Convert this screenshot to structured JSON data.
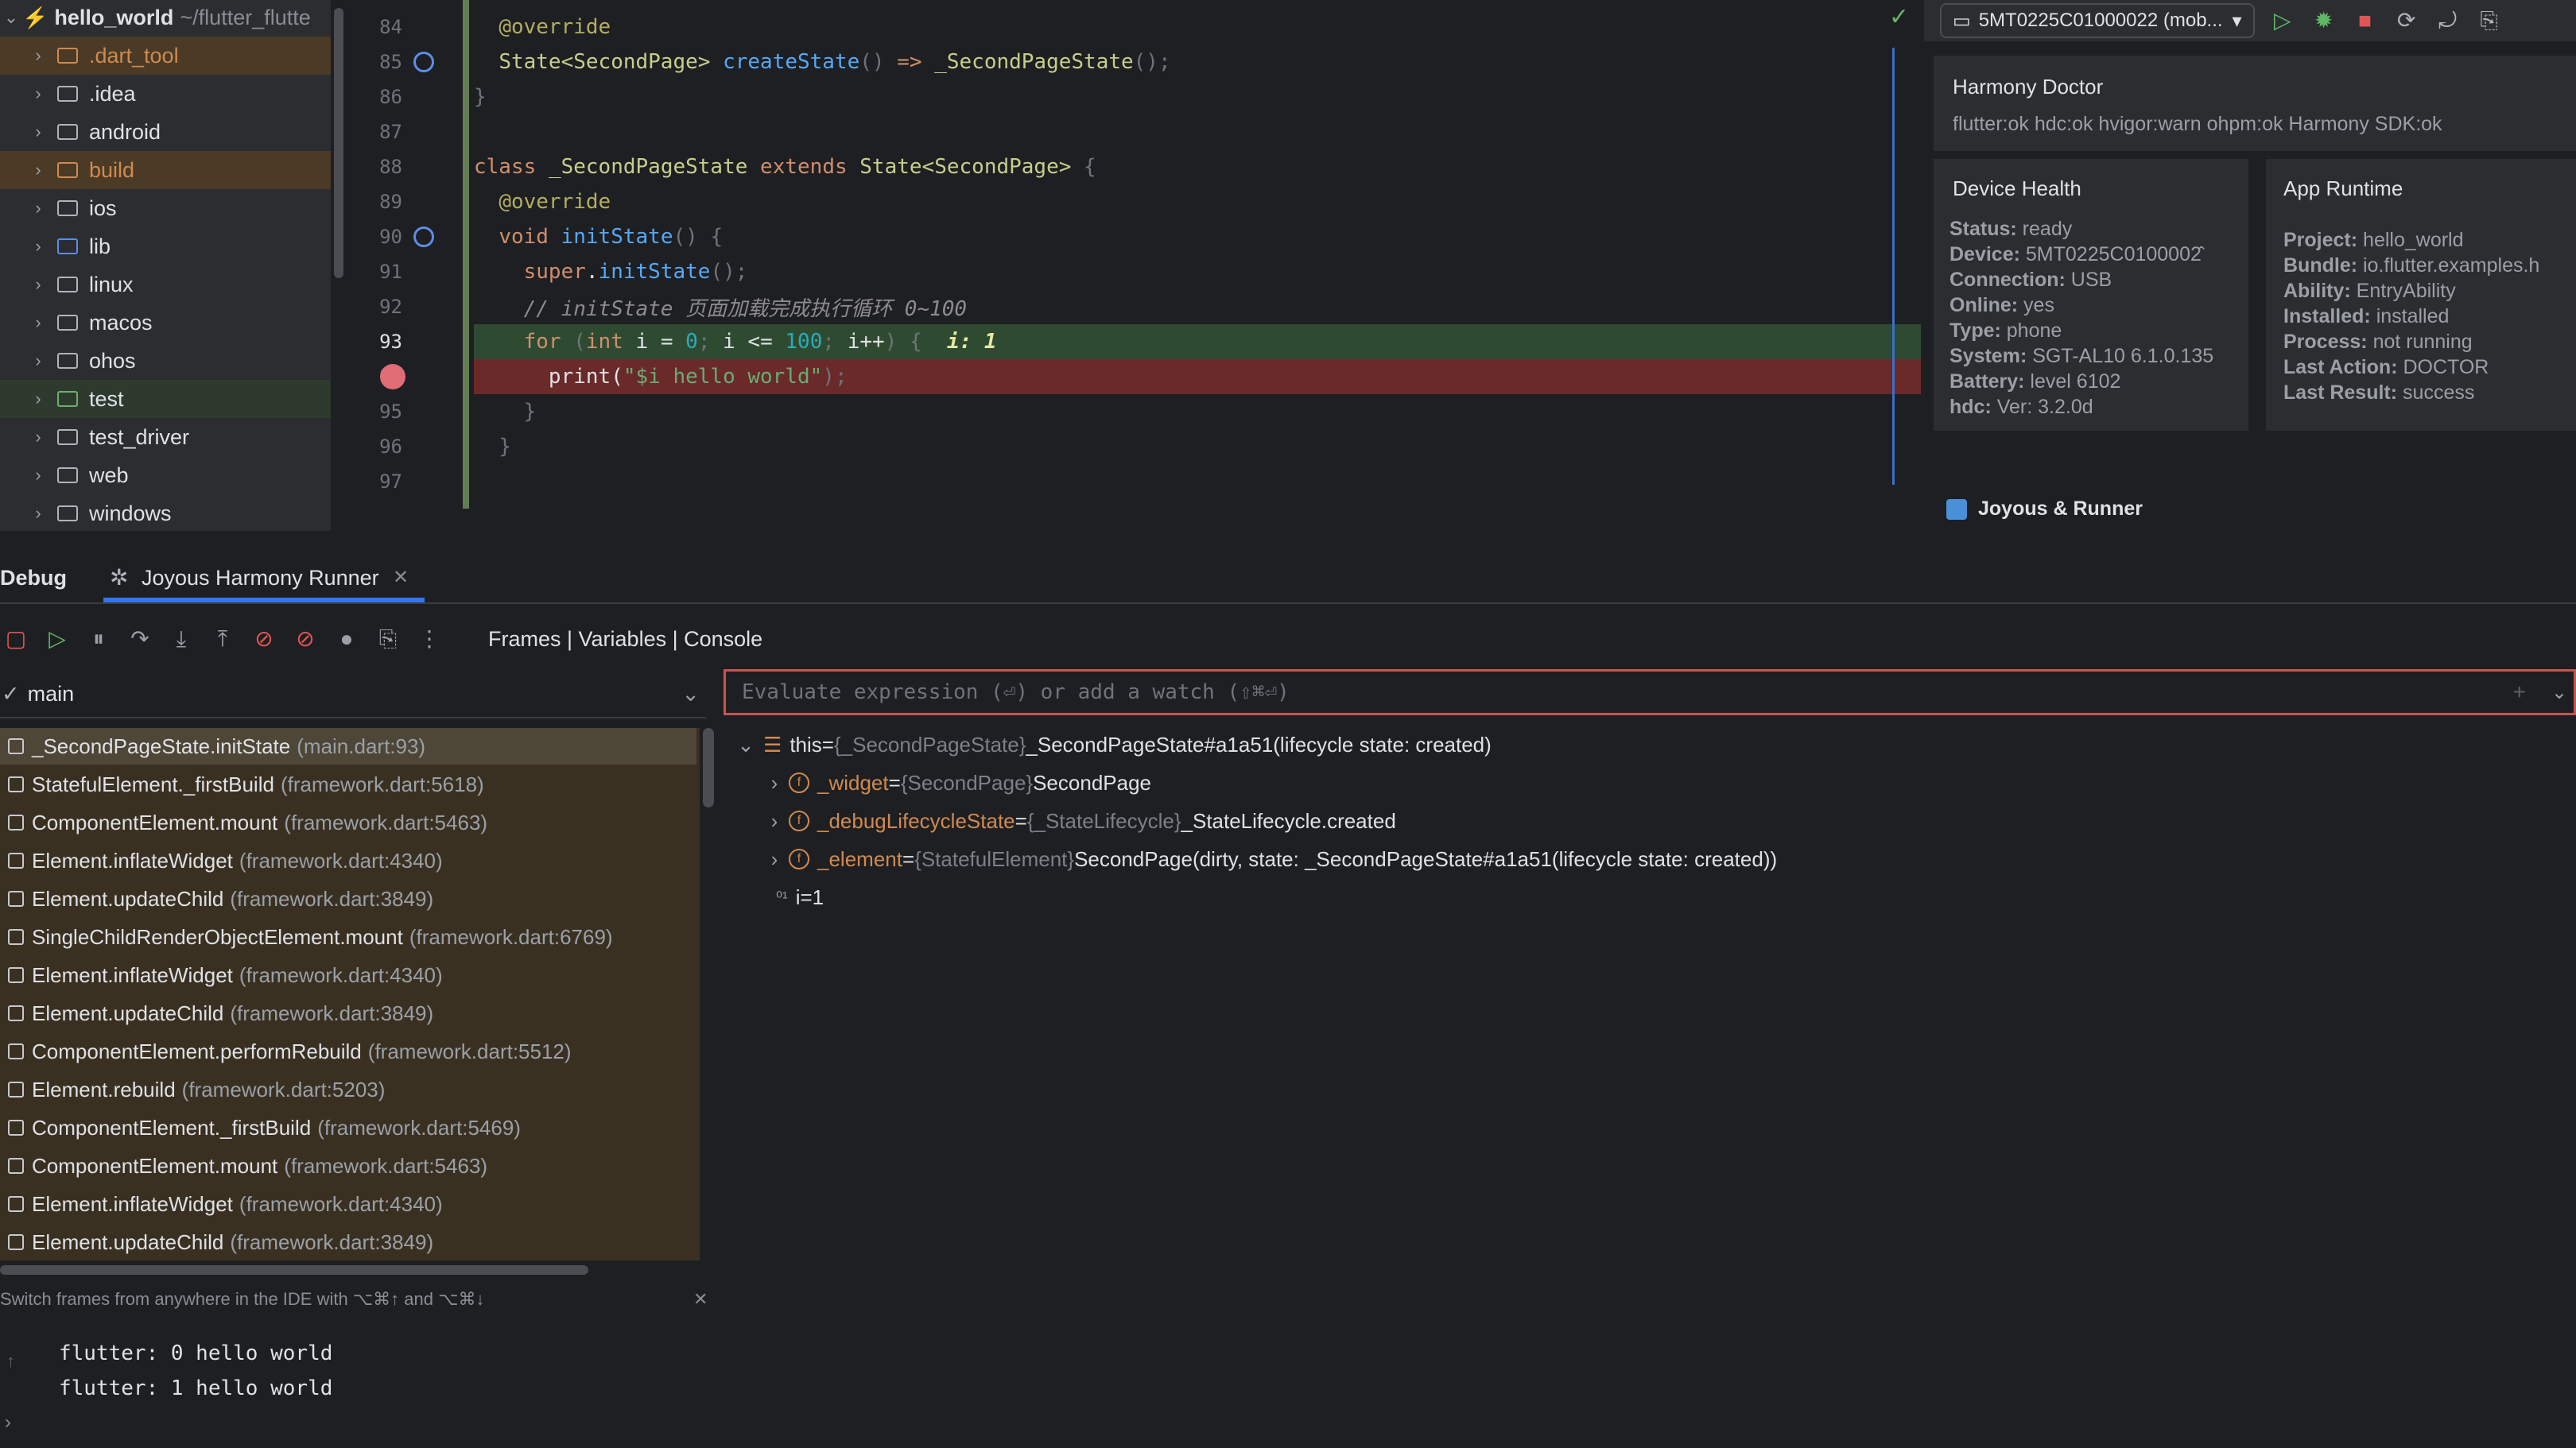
{
  "project": {
    "root_name": "hello_world",
    "root_path": "~/flutter_flutte"
  },
  "tree": [
    {
      "label": ".dart_tool",
      "style": "orange"
    },
    {
      "label": ".idea",
      "style": "normal"
    },
    {
      "label": "android",
      "style": "normal"
    },
    {
      "label": "build",
      "style": "orange"
    },
    {
      "label": "ios",
      "style": "normal"
    },
    {
      "label": "lib",
      "style": "blue"
    },
    {
      "label": "linux",
      "style": "normal"
    },
    {
      "label": "macos",
      "style": "normal"
    },
    {
      "label": "ohos",
      "style": "normal"
    },
    {
      "label": "test",
      "style": "green"
    },
    {
      "label": "test_driver",
      "style": "normal"
    },
    {
      "label": "web",
      "style": "normal"
    },
    {
      "label": "windows",
      "style": "normal"
    }
  ],
  "editor": {
    "line_numbers": [
      "84",
      "85",
      "86",
      "87",
      "88",
      "89",
      "90",
      "91",
      "92",
      "93",
      "94",
      "95",
      "96",
      "97"
    ],
    "current_line": "93",
    "inline_hint": "i: 1"
  },
  "toolbar": {
    "device": "5MT0225C01000022 (mob..."
  },
  "doctor": {
    "title": "Harmony Doctor",
    "status_line": "flutter:ok  hdc:ok  hvigor:warn  ohpm:ok  Harmony SDK:ok"
  },
  "device_health": {
    "title": "Device Health",
    "rows": [
      {
        "k": "Status:",
        "v": " ready"
      },
      {
        "k": "Device:",
        "v": " 5MT0225C0100002̂"
      },
      {
        "k": "Connection:",
        "v": " USB"
      },
      {
        "k": "Online:",
        "v": " yes"
      },
      {
        "k": "Type:",
        "v": " phone"
      },
      {
        "k": "System:",
        "v": " SGT-AL10 6.1.0.135"
      },
      {
        "k": "Battery:",
        "v": " level 6102"
      },
      {
        "k": "hdc:",
        "v": " Ver: 3.2.0d"
      }
    ]
  },
  "app_runtime": {
    "title": "App Runtime",
    "rows": [
      {
        "k": "Project:",
        "v": " hello_world"
      },
      {
        "k": "Bundle:",
        "v": " io.flutter.examples.h"
      },
      {
        "k": "Ability:",
        "v": " EntryAbility"
      },
      {
        "k": "Installed:",
        "v": " installed"
      },
      {
        "k": "Process:",
        "v": " not running"
      },
      {
        "k": "Last Action:",
        "v": " DOCTOR"
      },
      {
        "k": "Last Result:",
        "v": " success"
      }
    ]
  },
  "runner_label": "Joyous & Runner",
  "debug": {
    "tab_debug": "Debug",
    "tab_runner": "Joyous Harmony Runner",
    "panel_title": "Frames | Variables | Console",
    "thread": "main",
    "eval_placeholder": "Evaluate expression (⏎) or add a watch (⇧⌘⏎)",
    "hint": "Switch frames from anywhere in the IDE with ⌥⌘↑ and ⌥⌘↓"
  },
  "frames": [
    {
      "name": "_SecondPageState.initState",
      "loc": "(main.dart:93)"
    },
    {
      "name": "StatefulElement._firstBuild",
      "loc": "(framework.dart:5618)"
    },
    {
      "name": "ComponentElement.mount",
      "loc": "(framework.dart:5463)"
    },
    {
      "name": "Element.inflateWidget",
      "loc": "(framework.dart:4340)"
    },
    {
      "name": "Element.updateChild",
      "loc": "(framework.dart:3849)"
    },
    {
      "name": "SingleChildRenderObjectElement.mount",
      "loc": "(framework.dart:6769)"
    },
    {
      "name": "Element.inflateWidget",
      "loc": "(framework.dart:4340)"
    },
    {
      "name": "Element.updateChild",
      "loc": "(framework.dart:3849)"
    },
    {
      "name": "ComponentElement.performRebuild",
      "loc": "(framework.dart:5512)"
    },
    {
      "name": "Element.rebuild",
      "loc": "(framework.dart:5203)"
    },
    {
      "name": "ComponentElement._firstBuild",
      "loc": "(framework.dart:5469)"
    },
    {
      "name": "ComponentElement.mount",
      "loc": "(framework.dart:5463)"
    },
    {
      "name": "Element.inflateWidget",
      "loc": "(framework.dart:4340)"
    },
    {
      "name": "Element.updateChild",
      "loc": "(framework.dart:3849)"
    }
  ],
  "variables": [
    {
      "name": "this",
      "type": "{_SecondPageState}",
      "value": "_SecondPageState#a1a51(lifecycle state: created)"
    },
    {
      "name": "_widget",
      "type": "{SecondPage}",
      "value": "SecondPage"
    },
    {
      "name": "_debugLifecycleState",
      "type": "{_StateLifecycle}",
      "value": "_StateLifecycle.created"
    },
    {
      "name": "_element",
      "type": "{StatefulElement}",
      "value": "SecondPage(dirty, state: _SecondPageState#a1a51(lifecycle state: created))"
    },
    {
      "name": "i",
      "type": "",
      "value": "1"
    }
  ],
  "console": [
    "flutter: 0 hello world",
    "flutter: 1 hello world"
  ]
}
